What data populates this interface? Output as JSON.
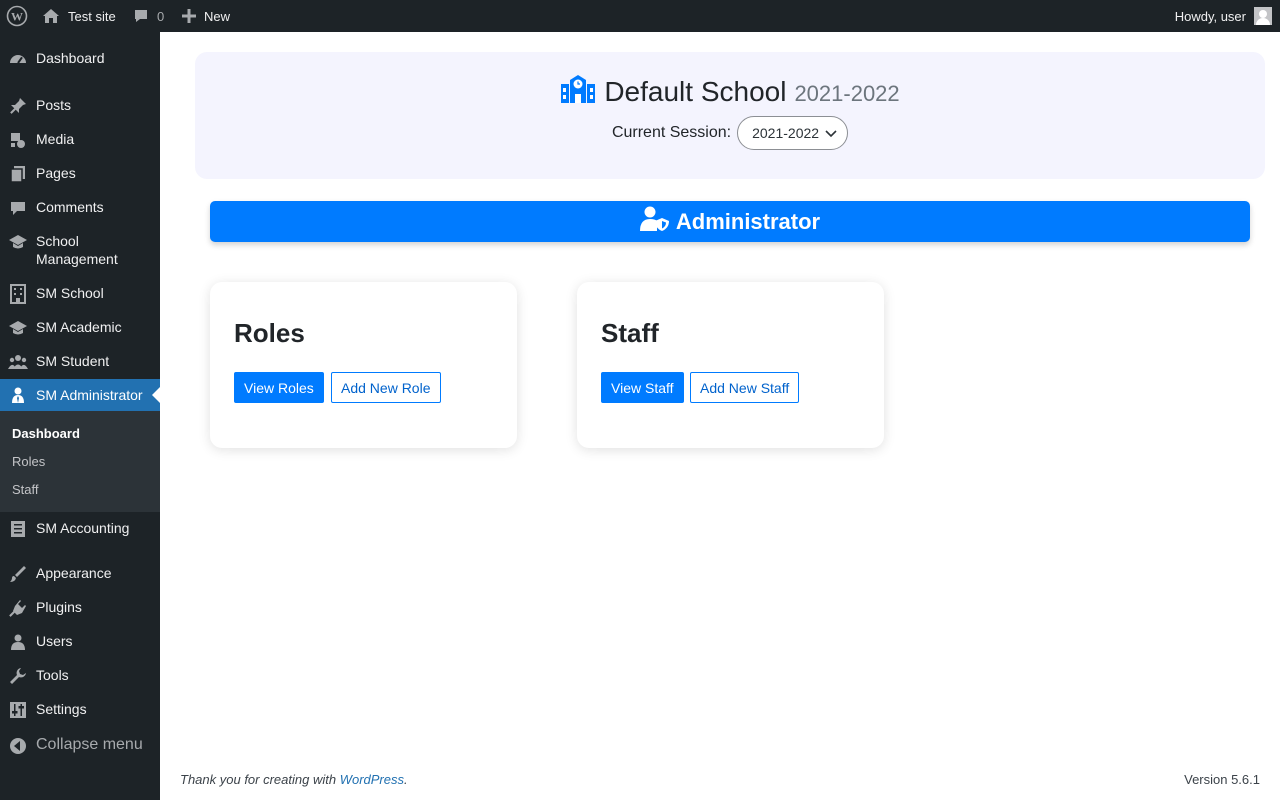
{
  "admin_bar": {
    "site_name": "Test site",
    "comment_count": "0",
    "new_label": "New",
    "howdy": "Howdy, user"
  },
  "sidebar": {
    "items": [
      {
        "label": "Dashboard",
        "icon": "dashboard-icon"
      },
      {
        "label": "Posts",
        "icon": "pin-icon"
      },
      {
        "label": "Media",
        "icon": "media-icon"
      },
      {
        "label": "Pages",
        "icon": "pages-icon"
      },
      {
        "label": "Comments",
        "icon": "comment-icon"
      },
      {
        "label": "School Management",
        "icon": "graduation-cap-icon"
      },
      {
        "label": "SM School",
        "icon": "building-icon"
      },
      {
        "label": "SM Academic",
        "icon": "graduation-cap-icon"
      },
      {
        "label": "SM Student",
        "icon": "users-icon"
      },
      {
        "label": "SM Administrator",
        "icon": "admin-user-icon"
      },
      {
        "label": "SM Accounting",
        "icon": "ledger-icon"
      },
      {
        "label": "Appearance",
        "icon": "brush-icon"
      },
      {
        "label": "Plugins",
        "icon": "plug-icon"
      },
      {
        "label": "Users",
        "icon": "user-icon"
      },
      {
        "label": "Tools",
        "icon": "wrench-icon"
      },
      {
        "label": "Settings",
        "icon": "sliders-icon"
      }
    ],
    "submenu": [
      "Dashboard",
      "Roles",
      "Staff"
    ],
    "collapse_label": "Collapse menu"
  },
  "header": {
    "school_name": "Default School",
    "session_label": "2021-2022",
    "current_session_label": "Current Session:",
    "session_select_value": "2021-2022"
  },
  "banner": {
    "title": "Administrator"
  },
  "cards": [
    {
      "title": "Roles",
      "primary_label": "View Roles",
      "secondary_label": "Add New Role"
    },
    {
      "title": "Staff",
      "primary_label": "View Staff",
      "secondary_label": "Add New Staff"
    }
  ],
  "footer": {
    "thanks_prefix": "Thank you for creating with",
    "wordpress_link": "WordPress",
    "thanks_suffix": ".",
    "version": "Version 5.6.1"
  },
  "colors": {
    "admin_bar": "#1d2327",
    "menu_active": "#2271b1",
    "primary": "#007bff",
    "header_panel": "#f4f4fe"
  }
}
